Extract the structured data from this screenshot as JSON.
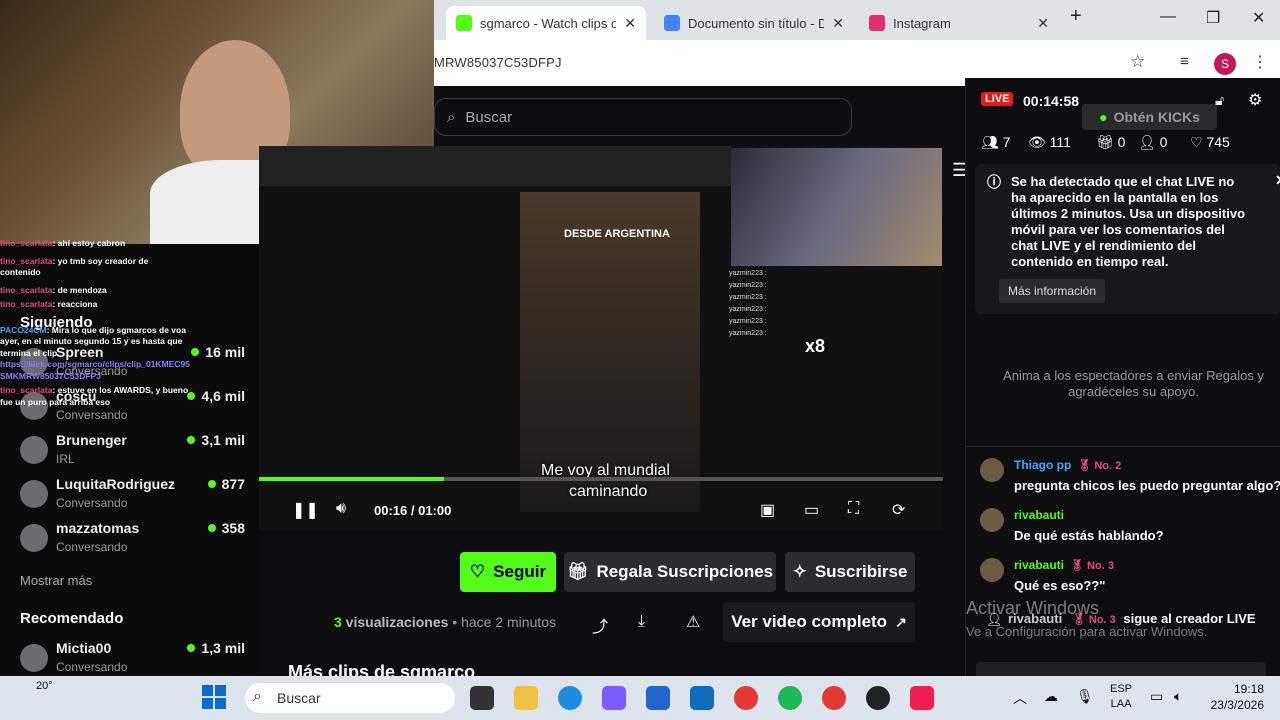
{
  "browser": {
    "tabs": [
      {
        "title": "sgmarco - Watch clips or",
        "fav_color": "#53fc18"
      },
      {
        "title": "Documento sin título - D",
        "fav_color": "#4285f4"
      },
      {
        "title": "Instagram",
        "fav_color": "#e1306c"
      }
    ],
    "new_tab": "+",
    "url": "MRW85037C53DFPJ",
    "profile_letter": "S"
  },
  "search": {
    "placeholder": "Buscar"
  },
  "sidebar": {
    "following_header": "Siguiendo",
    "following": [
      {
        "name": "Spreen",
        "status": "Conversando",
        "viewers": "16 mil"
      },
      {
        "name": "coscu",
        "status": "Conversando",
        "viewers": "4,6 mil"
      },
      {
        "name": "Brunenger",
        "status": "IRL",
        "viewers": "3,1 mil"
      },
      {
        "name": "LuquitaRodriguez",
        "status": "Conversando",
        "viewers": "877"
      },
      {
        "name": "mazzatomas",
        "status": "Conversando",
        "viewers": "358"
      }
    ],
    "show_more": "Mostrar más",
    "recommended_header": "Recomendado",
    "recommended": [
      {
        "name": "Mictia00",
        "status": "Conversando",
        "viewers": "1,3 mil"
      }
    ]
  },
  "overlay_chat": [
    {
      "user": "tino_scarlata",
      "text": ": ahí estoy cabron"
    },
    {
      "user": "tino_scarlata",
      "text": ": yo tmb soy creador de contenido"
    },
    {
      "user": "tino_scarlata",
      "text": ": de mendoza"
    },
    {
      "user": "tino_scarlata",
      "text": ": reacciona"
    },
    {
      "user": "PACO24CM",
      "text": ": Mira lo que dijo sgmarcos de voa ayer, en el minuto segundo 15 y es hasta que termina el clip"
    },
    {
      "user": "",
      "text": "https://kick.com/sgmarco/clips/clip_01KMEC95SMKMRW85037C53DFPJ"
    },
    {
      "user": "tino_scarlata",
      "text": ": estuve en los AWARDS, y bueno fue un puro para arriba eso"
    }
  ],
  "video": {
    "phone_caption": "DESDE ARGENTINA",
    "subtitle_line1": "Me voy al mundial",
    "subtitle_line2": "caminando",
    "time": "00:16 / 01:00",
    "progress": 0.27,
    "overlay_users": [
      "yazmin223 :",
      "yazmin223 :",
      "yazmin223 :",
      "yazmin223 :",
      "yazmin223 :",
      "yazmin223 :"
    ],
    "multiplier": "x8"
  },
  "actions": {
    "follow": "Seguir",
    "gift": "Regala Suscripciones",
    "subscribe": "Suscribirse",
    "views_count": "3",
    "views_label": " visualizaciones",
    "posted": "• hace 2 minutos",
    "full_video": "Ver video completo",
    "more_clips": "Más clips de sgmarco"
  },
  "chat": {
    "live": "LIVE",
    "duration": "00:14:58",
    "kicks_button": "Obtén KICKs",
    "stats": {
      "followers": "7",
      "views": "111",
      "gifts": "0",
      "subs": "0",
      "likes": "745"
    },
    "notice": "Se ha detectado que el chat LIVE no ha aparecido en la pantalla en los últimos 2 minutos. Usa un dispositivo móvil para ver los comentarios del chat LIVE y el rendimiento del contenido en tiempo real.",
    "notice_more": "Más información",
    "gift_hint": "Anima a los espectadores a enviar Regalos y agradéceles su apoyo.",
    "messages": [
      {
        "user": "Thiago pp",
        "badge": "No. 2",
        "text": "pregunta chicos les puedo preguntar algo?"
      },
      {
        "user": "rivabauti",
        "badge": "",
        "text": "De qué estás hablando?"
      },
      {
        "user": "rivabauti",
        "badge": "No. 3",
        "text": "Qué es eso??\""
      }
    ],
    "follow_event": {
      "user": "rivabauti",
      "badge": "No. 3",
      "text": "sigue al creador LIVE"
    },
    "activate_title": "Activar Windows",
    "activate_sub": "Ve a Configuración para activar Windows."
  },
  "taskbar": {
    "weather": "20°",
    "search": "Buscar",
    "lang1": "ESP",
    "lang2": "LAA",
    "time": "19:18",
    "date": "23/3/2026"
  }
}
